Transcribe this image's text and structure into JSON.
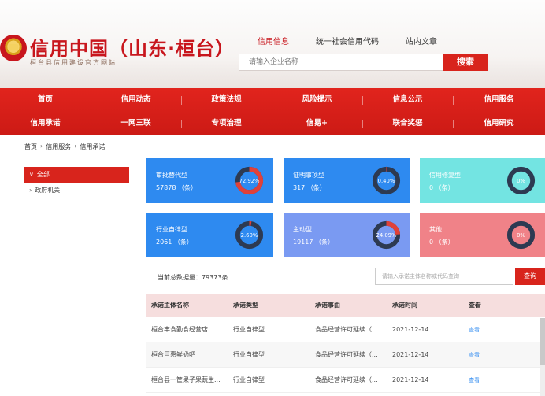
{
  "header": {
    "title": "信用中国（山东·桓台）",
    "subtitle": "桓台县信用建设官方网站",
    "search_tabs": [
      "信用信息",
      "统一社会信用代码",
      "站内文章"
    ],
    "search_placeholder": "请输入企业名称",
    "search_button": "搜索"
  },
  "nav": {
    "row1": [
      "首页",
      "信用动态",
      "政策法规",
      "风险提示",
      "信息公示",
      "信用服务"
    ],
    "row2": [
      "信用承诺",
      "一网三联",
      "专项治理",
      "信易+",
      "联合奖惩",
      "信用研究"
    ]
  },
  "breadcrumb": [
    "首页",
    "信用服务",
    "信用承诺"
  ],
  "sidebar": {
    "items": [
      {
        "label": "全部",
        "active": true
      },
      {
        "label": "政府机关",
        "active": false
      }
    ]
  },
  "cards": [
    {
      "label": "审批替代型",
      "value": "57878 （条）",
      "percent": "72.92%",
      "pct": 0.7292,
      "color": "#2e8af0"
    },
    {
      "label": "证明事项型",
      "value": "317 （条）",
      "percent": "0.40%",
      "pct": 0.004,
      "color": "#2e8af0"
    },
    {
      "label": "信用修复型",
      "value": "0 （条）",
      "percent": "0%",
      "pct": 0,
      "color": "#73e4e2"
    },
    {
      "label": "行业自律型",
      "value": "2061 （条）",
      "percent": "2.60%",
      "pct": 0.026,
      "color": "#2e8af0"
    },
    {
      "label": "主动型",
      "value": "19117 （条）",
      "percent": "24.09%",
      "pct": 0.2409,
      "color": "#7a9af2"
    },
    {
      "label": "其他",
      "value": "0 （条）",
      "percent": "0%",
      "pct": 0,
      "color": "#f08288"
    }
  ],
  "data_count": "当前总数据量：79373条",
  "query": {
    "placeholder": "请输入承诺主体名称或代码查询",
    "button": "查询"
  },
  "table": {
    "headers": [
      "承诺主体名称",
      "承诺类型",
      "承诺事由",
      "承诺时间",
      "查看"
    ],
    "rows": [
      [
        "桓台丰食勤食经营店",
        "行业自律型",
        "食品经营许可延续（...",
        "2021-12-14",
        "查看"
      ],
      [
        "桓台巨惠鲜奶吧",
        "行业自律型",
        "食品经营许可延续（...",
        "2021-12-14",
        "查看"
      ],
      [
        "桓台县一筐果子果蔬生...",
        "行业自律型",
        "食品经营许可延续（...",
        "2021-12-14",
        "查看"
      ]
    ]
  }
}
